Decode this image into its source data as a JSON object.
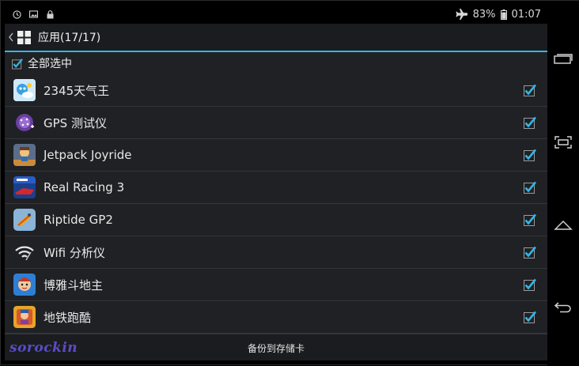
{
  "statusbar": {
    "icons_left": [
      "clock-icon",
      "image-icon",
      "lock-icon"
    ],
    "battery_percent": "83%",
    "time": "01:07"
  },
  "actionbar": {
    "title": "应用(17/17)"
  },
  "select_all": {
    "label": "全部选中",
    "checked": true
  },
  "apps": [
    {
      "name": "2345天气王",
      "icon": "weather-app-icon",
      "checked": true
    },
    {
      "name": "GPS 测试仪",
      "icon": "gps-app-icon",
      "checked": true
    },
    {
      "name": "Jetpack Joyride",
      "icon": "jetpack-app-icon",
      "checked": true
    },
    {
      "name": "Real Racing 3",
      "icon": "racing-app-icon",
      "checked": true
    },
    {
      "name": "Riptide GP2",
      "icon": "riptide-app-icon",
      "checked": true
    },
    {
      "name": "Wifi 分析仪",
      "icon": "wifi-app-icon",
      "checked": true
    },
    {
      "name": "博雅斗地主",
      "icon": "cards-app-icon",
      "checked": true
    },
    {
      "name": "地铁跑酷",
      "icon": "subway-app-icon",
      "checked": true
    }
  ],
  "bottom": {
    "backup_label": "备份到存储卡"
  },
  "watermark": "sorockin",
  "colors": {
    "accent": "#33b5e5",
    "background": "#1f2124",
    "watermark": "#5a4cc9"
  }
}
